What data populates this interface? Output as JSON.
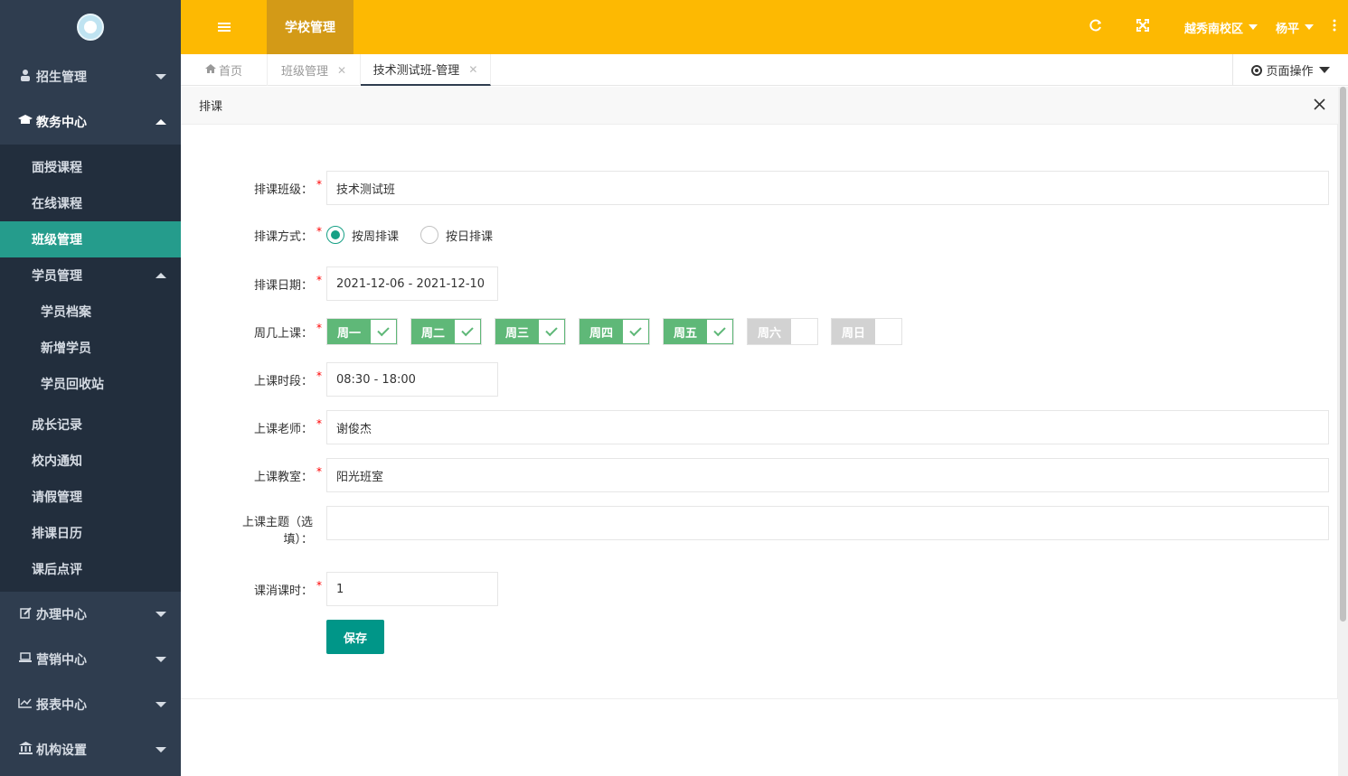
{
  "sidebar": {
    "groups": {
      "enroll": {
        "label": "招生管理",
        "icon": "user-icon"
      },
      "academic": {
        "label": "教务中心",
        "icon": "graduation-cap-icon"
      },
      "handle": {
        "label": "办理中心",
        "icon": "edit-icon"
      },
      "marketing": {
        "label": "营销中心",
        "icon": "laptop-icon"
      },
      "reports": {
        "label": "报表中心",
        "icon": "line-chart-icon"
      },
      "org": {
        "label": "机构设置",
        "icon": "bank-icon"
      }
    },
    "academic_items": {
      "offline": "面授课程",
      "online": "在线课程",
      "class_mgmt": "班级管理",
      "student_mgmt": "学员管理",
      "student_files": "学员档案",
      "add_student": "新增学员",
      "student_recycle": "学员回收站",
      "growth": "成长记录",
      "notice": "校内通知",
      "leave": "请假管理",
      "calendar": "排课日历",
      "review": "课后点评"
    }
  },
  "topbar": {
    "active_module": "学校管理",
    "campus": "越秀南校区",
    "user": "杨平",
    "colors": {
      "bar": "#fdb902",
      "active_tab": "#d39a17"
    }
  },
  "tabs": {
    "home": "首页",
    "class_mgmt": "班级管理",
    "current": "技术测试班-管理",
    "page_ops": "页面操作"
  },
  "panel": {
    "title": "排课"
  },
  "form": {
    "class_label": "排课班级：",
    "class_value": "技术测试班",
    "mode_label": "排课方式：",
    "mode_weekly": "按周排课",
    "mode_daily": "按日排课",
    "date_label": "排课日期：",
    "date_value": "2021-12-06 - 2021-12-10",
    "days_label": "周几上课：",
    "days": {
      "mon": {
        "label": "周一",
        "on": true
      },
      "tue": {
        "label": "周二",
        "on": true
      },
      "wed": {
        "label": "周三",
        "on": true
      },
      "thu": {
        "label": "周四",
        "on": true
      },
      "fri": {
        "label": "周五",
        "on": true
      },
      "sat": {
        "label": "周六",
        "on": false
      },
      "sun": {
        "label": "周日",
        "on": false
      }
    },
    "time_label": "上课时段：",
    "time_value": "08:30 - 18:00",
    "teacher_label": "上课老师：",
    "teacher_value": "谢俊杰",
    "room_label": "上课教室：",
    "room_value": "阳光班室",
    "topic_label": "上课主题（选填）：",
    "topic_value": "",
    "hours_label": "课消课时：",
    "hours_value": "1",
    "save": "保存",
    "required_mark": "*"
  }
}
